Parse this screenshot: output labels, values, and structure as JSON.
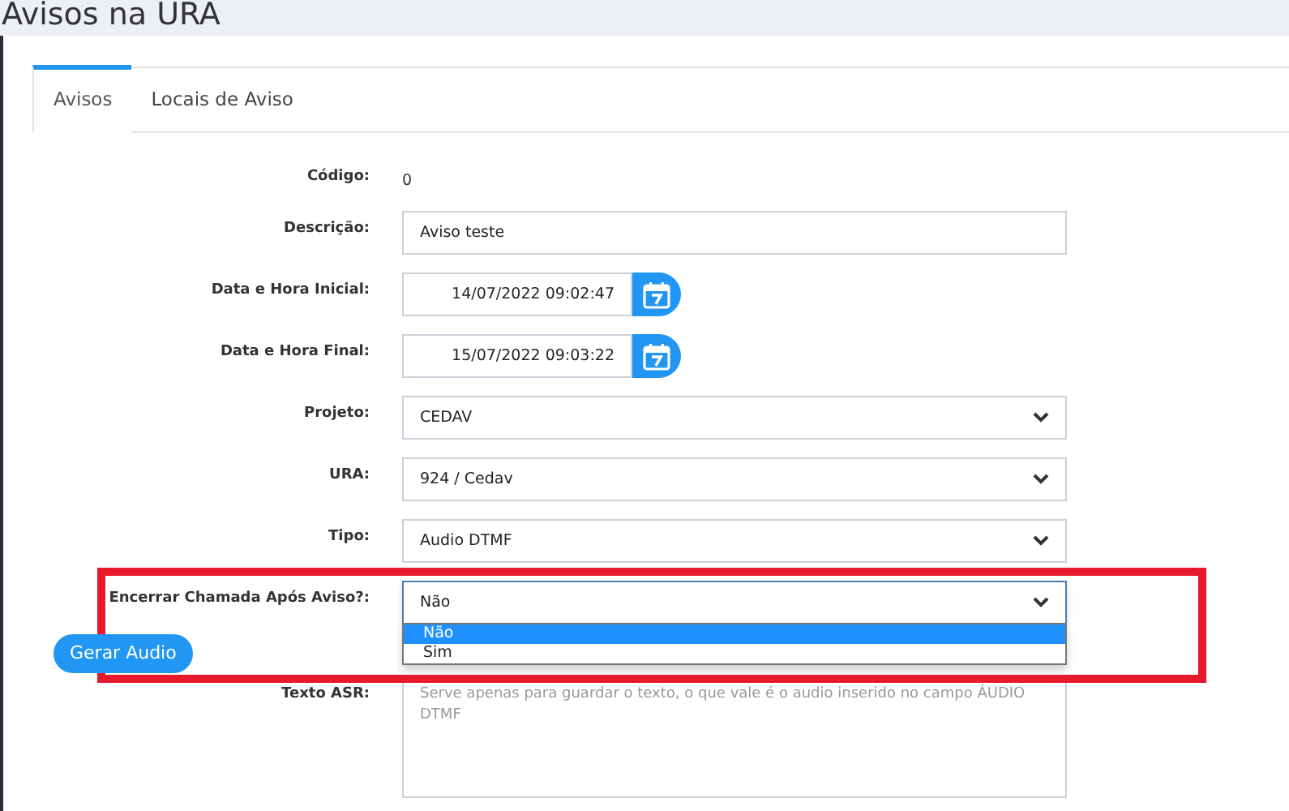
{
  "page": {
    "title": "Avisos na URA"
  },
  "tabs": [
    {
      "label": "Avisos",
      "selected": true
    },
    {
      "label": "Locais de Aviso",
      "selected": false
    }
  ],
  "rows": [
    {
      "kind": "static",
      "label": "Código:",
      "value": "0"
    },
    {
      "kind": "input",
      "label": "Descrição:",
      "value": "Aviso teste"
    },
    {
      "kind": "datetime",
      "label": "Data e Hora Inicial:",
      "value": "14/07/2022 09:02:47"
    },
    {
      "kind": "datetime",
      "label": "Data e Hora Final:",
      "value": "15/07/2022 09:03:22"
    },
    {
      "kind": "select",
      "label": "Projeto:",
      "value": "CEDAV",
      "expanded": false
    },
    {
      "kind": "select",
      "label": "URA:",
      "value": "924 / Cedav",
      "expanded": false
    },
    {
      "kind": "select",
      "label": "Tipo:",
      "value": "Audio DTMF",
      "expanded": false
    },
    {
      "kind": "select",
      "label": "Encerrar Chamada Após Aviso?:",
      "value": "Não",
      "expanded": true,
      "options": [
        {
          "label": "Não",
          "selected": true
        },
        {
          "label": "Sim",
          "selected": false
        }
      ]
    },
    {
      "kind": "button",
      "label": "Gerar Audio"
    },
    {
      "kind": "textarea",
      "label": "Texto ASR:",
      "placeholder": "Serve apenas para guardar o texto, o que vale é o audio inserido no campo ÁUDIO DTMF"
    }
  ]
}
